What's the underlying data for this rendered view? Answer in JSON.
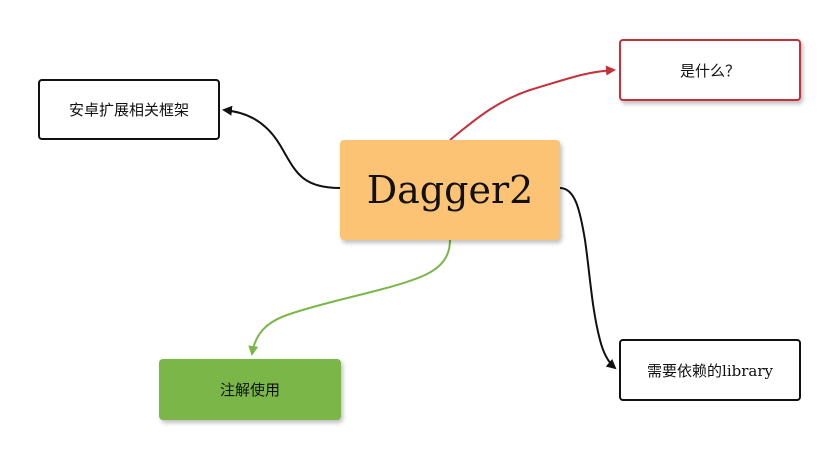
{
  "diagram": {
    "center": {
      "label": "Dagger2"
    },
    "nodes": {
      "left": {
        "label": "安卓扩展相关框架"
      },
      "top_right": {
        "label": "是什么？"
      },
      "bottom_right": {
        "label": "需要依赖的library"
      },
      "bottom_left": {
        "label": "注解使用"
      }
    },
    "colors": {
      "center_fill": "#fdc374",
      "red_edge": "#c4313a",
      "green_edge": "#7ab648",
      "black_edge": "#111111",
      "green_node_fill": "#7ab648"
    }
  }
}
